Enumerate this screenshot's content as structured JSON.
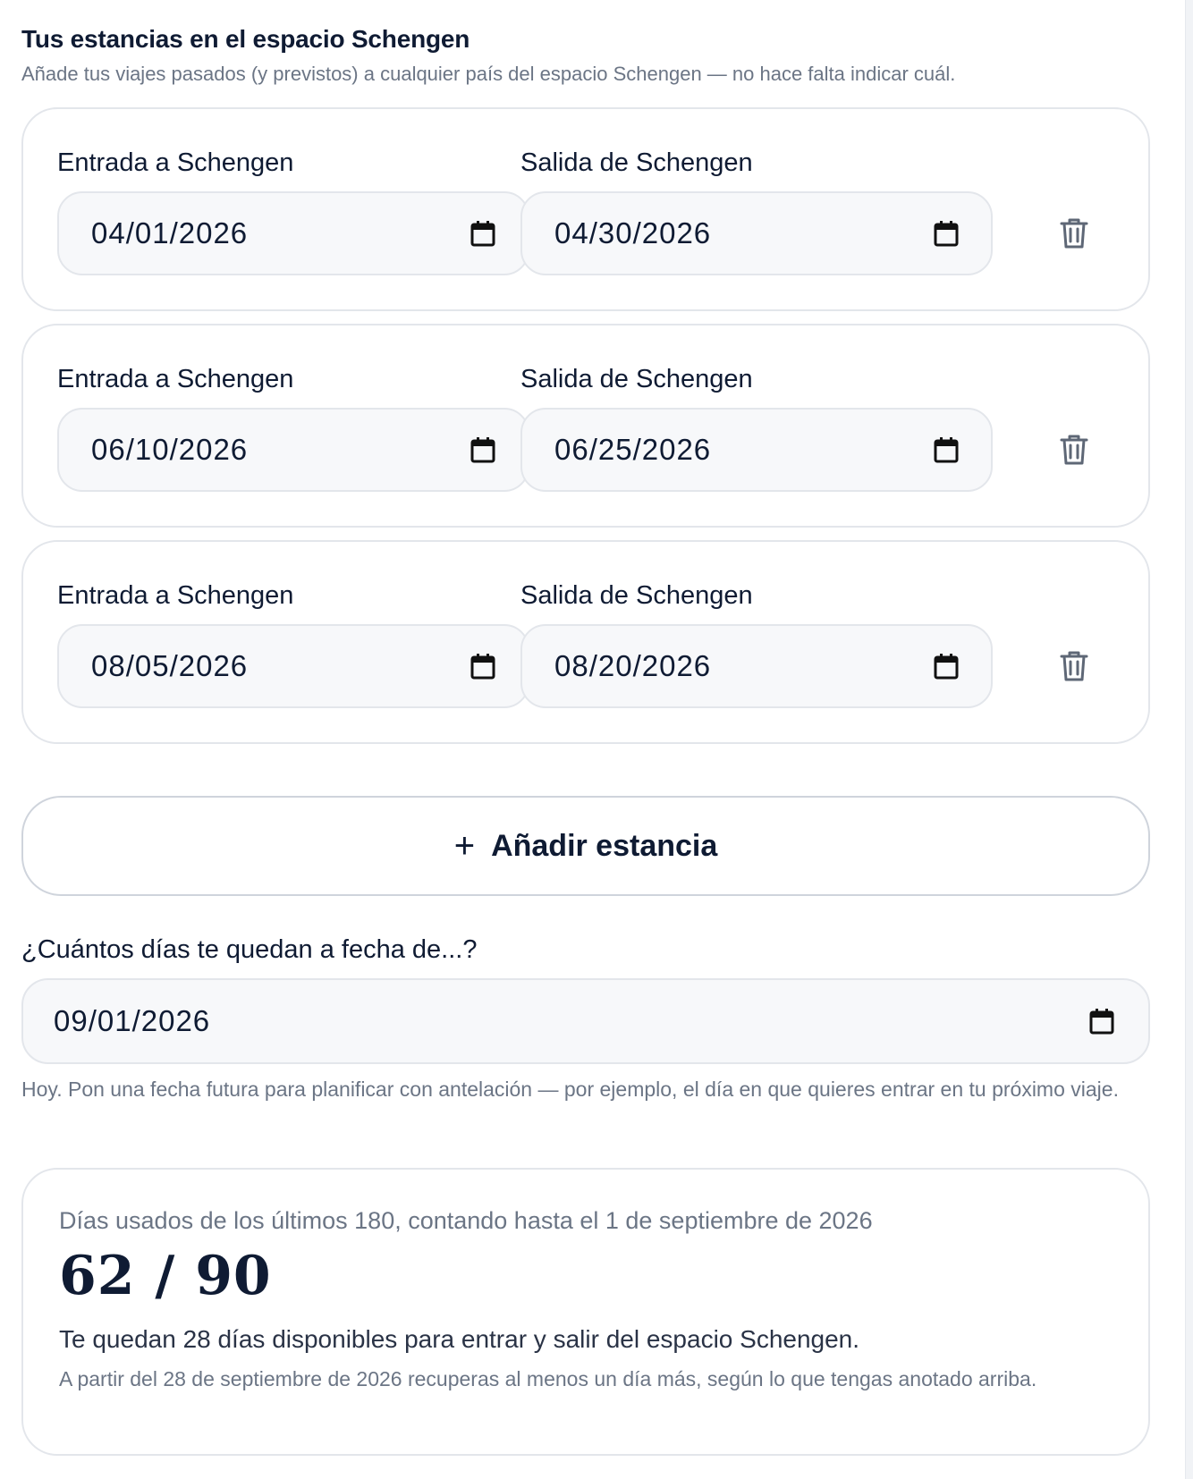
{
  "section": {
    "title": "Tus estancias en el espacio Schengen",
    "subtitle": "Añade tus viajes pasados (y previstos) a cualquier país del espacio Schengen — no hace falta indicar cuál."
  },
  "stays": [
    {
      "entry_label": "Entrada a Schengen",
      "entry_value": "04/01/2026",
      "exit_label": "Salida de Schengen",
      "exit_value": "04/30/2026"
    },
    {
      "entry_label": "Entrada a Schengen",
      "entry_value": "06/10/2026",
      "exit_label": "Salida de Schengen",
      "exit_value": "06/25/2026"
    },
    {
      "entry_label": "Entrada a Schengen",
      "entry_value": "08/05/2026",
      "exit_label": "Salida de Schengen",
      "exit_value": "08/20/2026"
    }
  ],
  "add_stay": {
    "icon": "plus-icon",
    "label": "Añadir estancia"
  },
  "as_of": {
    "label": "¿Cuántos días te quedan a fecha de...?",
    "value": "09/01/2026",
    "hint": "Hoy. Pon una fecha futura para planificar con antelación — por ejemplo, el día en que quieres entrar en tu próximo viaje."
  },
  "result": {
    "caption": "Días usados de los últimos 180, contando hasta el 1 de septiembre de 2026",
    "count": "62 / 90",
    "remaining": "Te quedan 28 días disponibles para entrar y salir del espacio Schengen.",
    "note": "A partir del 28 de septiembre de 2026 recuperas al menos un día más, según lo que tengas anotado arriba."
  },
  "icons": {
    "calendar": "calendar-icon",
    "delete": "trash-icon"
  },
  "colors": {
    "text": "#0f1b33",
    "muted": "#6b7585",
    "border": "#e3e6eb",
    "input_bg": "#f7f8fa"
  }
}
